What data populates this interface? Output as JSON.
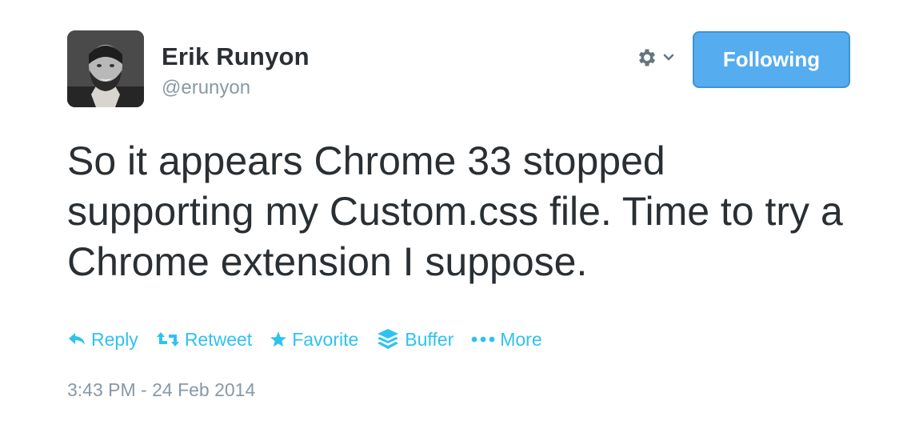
{
  "author": {
    "name": "Erik Runyon",
    "handle": "@erunyon"
  },
  "header": {
    "follow_button_label": "Following",
    "settings_icon": "gear-icon",
    "dropdown_icon": "chevron-down-icon"
  },
  "tweet": {
    "text": "So it appears Chrome 33 stopped supporting my Custom.css file. Time to try a Chrome extension I suppose.",
    "timestamp": "3:43 PM - 24 Feb 2014"
  },
  "actions": [
    {
      "label": "Reply",
      "icon": "reply-icon"
    },
    {
      "label": "Retweet",
      "icon": "retweet-icon"
    },
    {
      "label": "Favorite",
      "icon": "star-icon"
    },
    {
      "label": "Buffer",
      "icon": "buffer-icon"
    },
    {
      "label": "More",
      "icon": "more-dots-icon"
    }
  ],
  "colors": {
    "accent": "#55acee",
    "action_link": "#2fc2ef",
    "muted": "#8899a6",
    "text": "#292f33"
  }
}
